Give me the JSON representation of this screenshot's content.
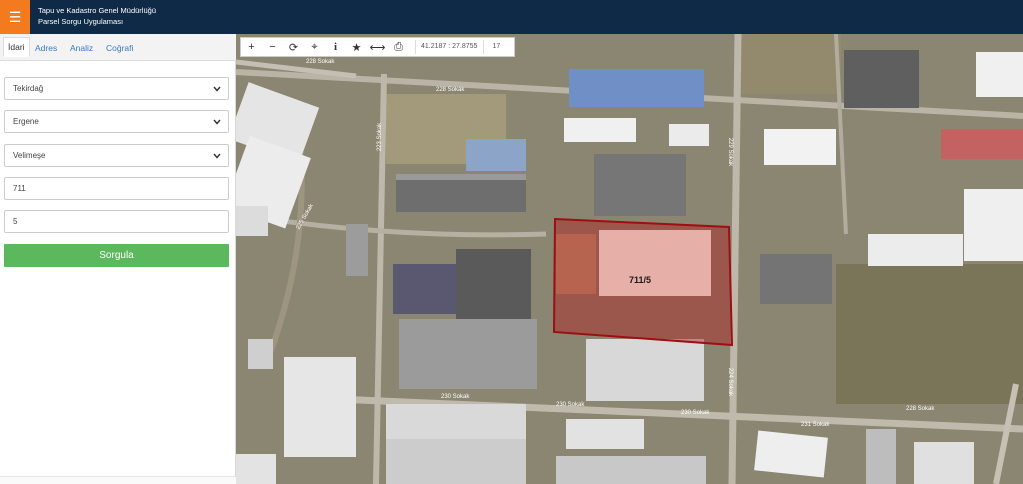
{
  "header": {
    "title_line1": "Tapu ve Kadastro Genel Müdürlüğü",
    "title_line2": "Parsel Sorgu Uygulaması",
    "menu_icon": "hamburger-icon",
    "colors": {
      "bar": "#0e2a47",
      "menu": "#f47a20"
    }
  },
  "tabs": [
    {
      "label": "İdari",
      "active": true
    },
    {
      "label": "Adres"
    },
    {
      "label": "Analiz"
    },
    {
      "label": "Coğrafi"
    }
  ],
  "form": {
    "province": "Tekirdağ",
    "district": "Ergene",
    "neighborhood": "Velimeşe",
    "block": "711",
    "parcel": "5",
    "submit_label": "Sorgula",
    "submit_color": "#5cb85c"
  },
  "toolbar": {
    "tools": [
      "zoom-in-icon",
      "zoom-out-icon",
      "refresh-icon",
      "locate-icon",
      "info-icon",
      "star-icon",
      "measure-icon",
      "print-icon"
    ],
    "glyphs": [
      "+",
      "−",
      "⟳",
      "⌖",
      "i",
      "★",
      "⟷",
      "⎙"
    ],
    "coordinates": "41.2187 : 27.8755",
    "zoom": "17"
  },
  "map": {
    "parcel_label": "711/5",
    "parcel_color": "#b0201e",
    "roads": [
      "228 Sokak",
      "223 Sokak",
      "229 Sokak",
      "225 Sokak",
      "224 Sokak",
      "230 Sokak",
      "230 Sokak",
      "230 Sokak",
      "231 Sokak",
      "228 Sokak",
      "228 Sokak"
    ]
  }
}
